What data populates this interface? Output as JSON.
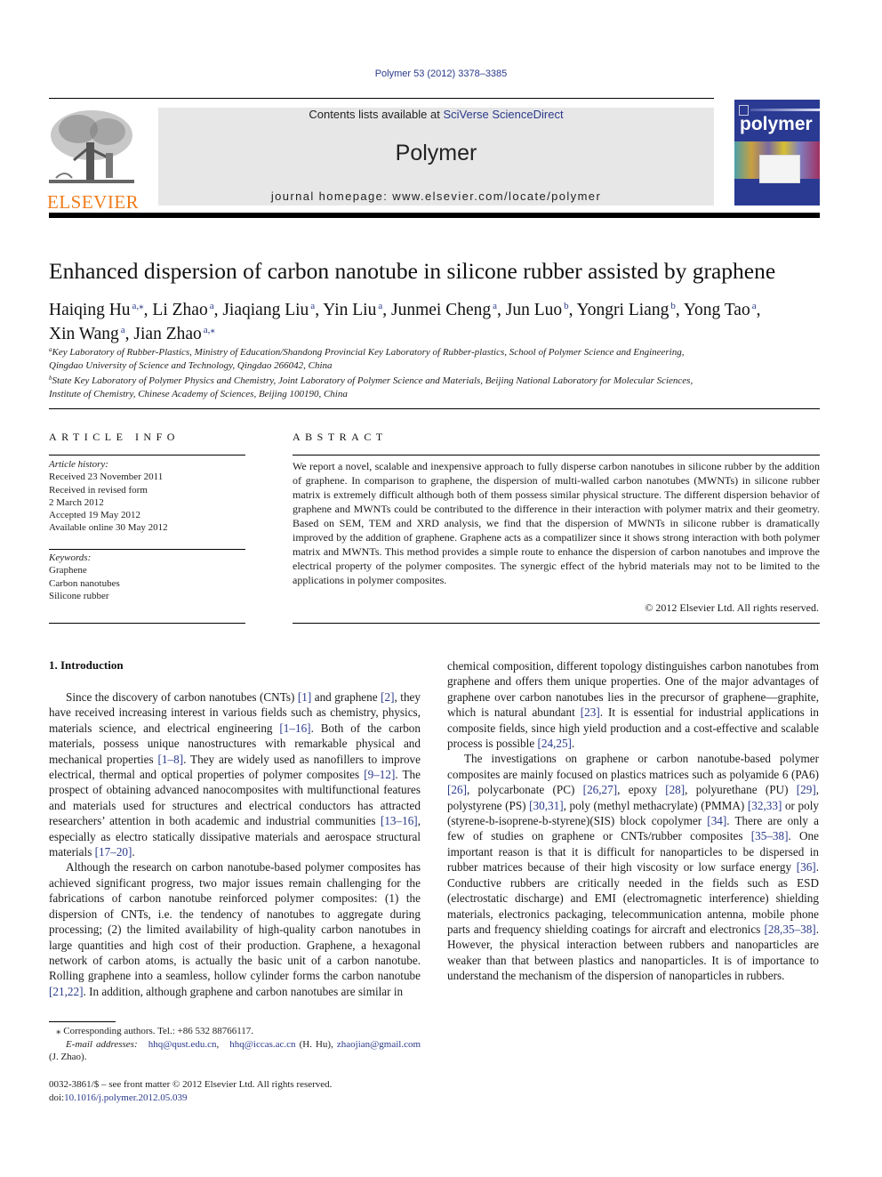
{
  "header": {
    "journal_ref": "Polymer 53 (2012) 3378–3385",
    "contents_prefix": "Contents lists available at ",
    "contents_link": "SciVerse ScienceDirect",
    "journal_name": "Polymer",
    "homepage": "journal homepage: www.elsevier.com/locate/polymer",
    "publisher_logo_text": "ELSEVIER",
    "cover_title": "polymer",
    "colors": {
      "link": "#2a3a8a",
      "publisher_orange": "#f07c1a",
      "banner_bg": "#e7e7e7",
      "cover_blue": "#2a3a92"
    }
  },
  "article": {
    "title": "Enhanced dispersion of carbon nanotube in silicone rubber assisted by graphene",
    "authors": [
      {
        "name": "Haiqing Hu",
        "aff": "a,⁎"
      },
      {
        "name": "Li Zhao",
        "aff": "a"
      },
      {
        "name": "Jiaqiang Liu",
        "aff": "a"
      },
      {
        "name": "Yin Liu",
        "aff": "a"
      },
      {
        "name": "Junmei Cheng",
        "aff": "a"
      },
      {
        "name": "Jun Luo",
        "aff": "b"
      },
      {
        "name": "Yongri Liang",
        "aff": "b"
      },
      {
        "name": "Yong Tao",
        "aff": "a"
      },
      {
        "name": "Xin Wang",
        "aff": "a"
      },
      {
        "name": "Jian Zhao",
        "aff": "a,⁎"
      }
    ],
    "affiliations": [
      {
        "mark": "a",
        "line1": "Key Laboratory of Rubber-Plastics, Ministry of Education/Shandong Provincial Key Laboratory of Rubber-plastics, School of Polymer Science and Engineering,",
        "line2": "Qingdao University of Science and Technology, Qingdao 266042, China"
      },
      {
        "mark": "b",
        "line1": "State Key Laboratory of Polymer Physics and Chemistry, Joint Laboratory of Polymer Science and Materials, Beijing National Laboratory for Molecular Sciences,",
        "line2": "Institute of Chemistry, Chinese Academy of Sciences, Beijing 100190, China"
      }
    ]
  },
  "article_info": {
    "heading": "ARTICLE INFO",
    "history_label": "Article history:",
    "history": [
      "Received 23 November 2011",
      "Received in revised form",
      "2 March 2012",
      "Accepted 19 May 2012",
      "Available online 30 May 2012"
    ],
    "keywords_label": "Keywords:",
    "keywords": [
      "Graphene",
      "Carbon nanotubes",
      "Silicone rubber"
    ]
  },
  "abstract": {
    "heading": "ABSTRACT",
    "text": "We report a novel, scalable and inexpensive approach to fully disperse carbon nanotubes in silicone rubber by the addition of graphene. In comparison to graphene, the dispersion of multi-walled carbon nanotubes (MWNTs) in silicone rubber matrix is extremely difficult although both of them possess similar physical structure. The different dispersion behavior of graphene and MWNTs could be contributed to the difference in their interaction with polymer matrix and their geometry. Based on SEM, TEM and XRD analysis, we find that the dispersion of MWNTs in silicone rubber is dramatically improved by the addition of graphene. Graphene acts as a compatilizer since it shows strong interaction with both polymer matrix and MWNTs. This method provides a simple route to enhance the dispersion of carbon nanotubes and improve the electrical property of the polymer composites. The synergic effect of the hybrid materials may not to be limited to the applications in polymer composites.",
    "copyright": "© 2012 Elsevier Ltd. All rights reserved."
  },
  "introduction": {
    "heading": "1.  Introduction",
    "paragraphs": [
      {
        "indent": true,
        "segments": [
          {
            "t": "Since the discovery of carbon nanotubes (CNTs) "
          },
          {
            "r": "[1]"
          },
          {
            "t": " and graphene "
          },
          {
            "r": "[2]"
          },
          {
            "t": ", they have received increasing interest in various fields such as chemistry, physics, materials science, and electrical engineering "
          },
          {
            "r": "[1–16]"
          },
          {
            "t": ". Both of the carbon materials, possess unique nanostructures with remarkable physical and mechanical properties "
          },
          {
            "r": "[1–8]"
          },
          {
            "t": ". They are widely used as nanofillers to improve electrical, thermal and optical properties of polymer composites "
          },
          {
            "r": "[9–12]"
          },
          {
            "t": ". The prospect of obtaining advanced nanocomposites with multifunctional features and materials used for structures and electrical conductors has attracted researchers’ attention in both academic and industrial communities "
          },
          {
            "r": "[13–16]"
          },
          {
            "t": ", especially as electro statically dissipative materials and aerospace structural materials "
          },
          {
            "r": "[17–20]"
          },
          {
            "t": "."
          }
        ]
      },
      {
        "indent": true,
        "segments": [
          {
            "t": "Although the research on carbon nanotube-based polymer composites has achieved significant progress, two major issues remain challenging for the fabrications of carbon nanotube reinforced polymer composites: (1) the dispersion of CNTs, i.e. the tendency of nanotubes to aggregate during processing; (2) the limited availability of high-quality carbon nanotubes in large quantities and high cost of their production. Graphene, a hexagonal network of carbon atoms, is actually the basic unit of a carbon nanotube. Rolling graphene into a seamless, hollow cylinder forms the carbon nanotube "
          },
          {
            "r": "[21,22]"
          },
          {
            "t": ". In addition, although graphene and carbon nanotubes are similar in chemical composition, different topology distinguishes carbon nanotubes from graphene and offers them unique properties. One of the major advantages of graphene over carbon nanotubes lies in the precursor of graphene—graphite, which is natural abundant "
          },
          {
            "r": "[23]"
          },
          {
            "t": ". It is essential for industrial applications in composite fields, since high yield production and a cost-effective and scalable process is possible "
          },
          {
            "r": "[24,25]"
          },
          {
            "t": "."
          }
        ]
      },
      {
        "indent": true,
        "segments": [
          {
            "t": "The investigations on graphene or carbon nanotube-based polymer composites are mainly focused on plastics matrices such as polyamide 6 (PA6) "
          },
          {
            "r": "[26]"
          },
          {
            "t": ", polycarbonate (PC) "
          },
          {
            "r": "[26,27]"
          },
          {
            "t": ", epoxy "
          },
          {
            "r": "[28]"
          },
          {
            "t": ", polyurethane (PU) "
          },
          {
            "r": "[29]"
          },
          {
            "t": ", polystyrene (PS) "
          },
          {
            "r": "[30,31]"
          },
          {
            "t": ", poly (methyl methacrylate) (PMMA) "
          },
          {
            "r": "[32,33]"
          },
          {
            "t": " or poly (styrene-b-isoprene-b-styrene)(SIS) block copolymer "
          },
          {
            "r": "[34]"
          },
          {
            "t": ". There are only a few of studies on graphene or CNTs/rubber composites "
          },
          {
            "r": "[35–38]"
          },
          {
            "t": ". One important reason is that it is difficult for nanoparticles to be dispersed in rubber matrices because of their high viscosity or low surface energy "
          },
          {
            "r": "[36]"
          },
          {
            "t": ". Conductive rubbers are critically needed in the fields such as ESD (electrostatic discharge) and EMI (electromagnetic interference) shielding materials, electronics packaging, telecommunication antenna, mobile phone parts and frequency shielding coatings for aircraft and electronics "
          },
          {
            "r": "[28,35–38]"
          },
          {
            "t": ". However, the physical interaction between rubbers and nanoparticles are weaker than that between plastics and nanoparticles. It is of importance to understand the mechanism of the dispersion of nanoparticles in rubbers."
          }
        ]
      }
    ]
  },
  "footnote": {
    "corresponding": "⁎ Corresponding authors. Tel.: +86 532 88766117.",
    "email_label": "E-mail addresses:",
    "email1": "hhq@qust.edu.cn",
    "email2": "hhq@iccas.ac.cn",
    "email2_owner": " (H. Hu), ",
    "email3": "zhaojian@gmail.com",
    "email3_owner": " (J. Zhao)."
  },
  "front_matter": {
    "issn_line": "0032-3861/$ – see front matter © 2012 Elsevier Ltd. All rights reserved.",
    "doi_prefix": "doi:",
    "doi": "10.1016/j.polymer.2012.05.039"
  }
}
